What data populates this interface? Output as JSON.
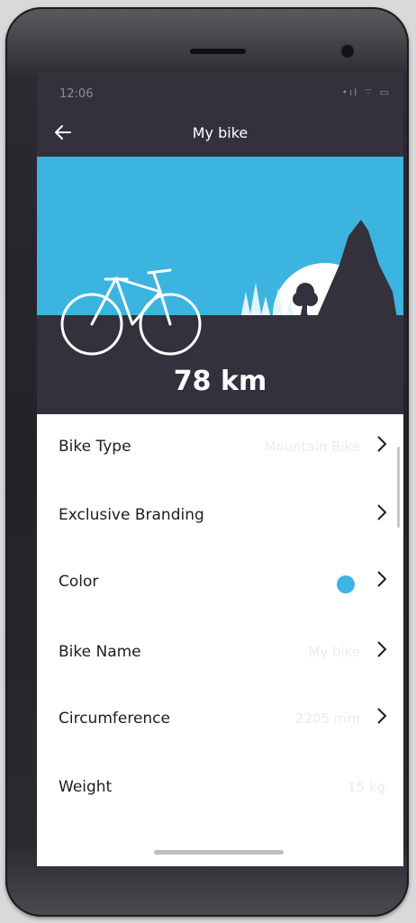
{
  "status_bar": {
    "time": "12:06",
    "icons": "•ıl ⌔ ▭"
  },
  "nav": {
    "title": "My bike",
    "back_icon": "arrow-left-icon"
  },
  "hero": {
    "distance": "78 km",
    "sky_color": "#3cb4e0",
    "ground_color": "#34313d"
  },
  "list": {
    "rows": [
      {
        "label": "Bike Type",
        "value": "Mountain Bike"
      },
      {
        "label": "Exclusive Branding",
        "value": ""
      },
      {
        "label": "Color",
        "value": "",
        "swatch": "#3fb3e3"
      },
      {
        "label": "Bike Name",
        "value": "My bike"
      },
      {
        "label": "Circumference",
        "value": "2205 mm"
      },
      {
        "label": "Weight",
        "value": "15 kg"
      }
    ]
  }
}
